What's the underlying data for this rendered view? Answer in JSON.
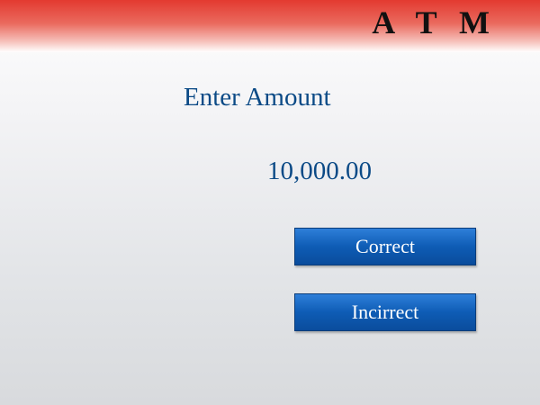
{
  "header": {
    "title": "A T M"
  },
  "screen": {
    "prompt": "Enter Amount",
    "amount": "10,000.00"
  },
  "buttons": {
    "correct_label": "Correct",
    "incorrect_label": "Incirrect"
  },
  "colors": {
    "header_red": "#e33a30",
    "text_blue": "#0b4a86",
    "button_blue": "#0e5cb5"
  }
}
